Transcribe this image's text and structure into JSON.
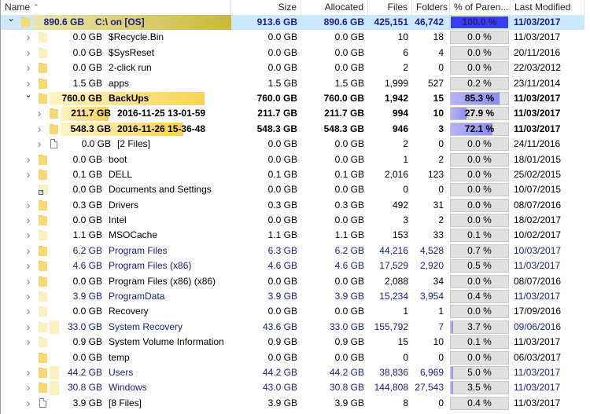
{
  "colors": {
    "selection": "#cce8ff",
    "blue_text": "#202080",
    "pct_fill": "#8c8cf2",
    "pct_fill_root": "#3c3cf0",
    "pct_bg": "#e0e0e0"
  },
  "columns": {
    "name": "Name",
    "size": "Size",
    "allocated": "Allocated",
    "files": "Files",
    "folders": "Folders",
    "percent": "% of Paren...",
    "modified": "Last Modified",
    "sort_icon": "sort-ascending-icon"
  },
  "rows": [
    {
      "level": 0,
      "expanded": true,
      "icon": "folder",
      "gb": "890.6 GB",
      "name": "C:\\  on  [OS]",
      "size": "913.6 GB",
      "allocated": "890.6 GB",
      "files": "425,151",
      "folders": "46,742",
      "percent": "100.0 %",
      "pct_value": 100.0,
      "modified": "11/03/2017",
      "bold": true,
      "blue": true,
      "selected": true,
      "size_fraction": 1.0
    },
    {
      "level": 1,
      "expanded": false,
      "icon": "folder-pale",
      "gb": "0.0 GB",
      "name": "$Recycle.Bin",
      "size": "0.0 GB",
      "allocated": "0.0 GB",
      "files": "10",
      "folders": "18",
      "percent": "0.0 %",
      "pct_value": 0.0,
      "modified": "11/03/2017"
    },
    {
      "level": 1,
      "expanded": false,
      "icon": "folder-pale",
      "gb": "0.0 GB",
      "name": "$SysReset",
      "size": "0.0 GB",
      "allocated": "0.0 GB",
      "files": "6",
      "folders": "4",
      "percent": "0.0 %",
      "pct_value": 0.0,
      "modified": "20/11/2016"
    },
    {
      "level": 1,
      "expanded": false,
      "icon": "folder",
      "gb": "0.0 GB",
      "name": "2-click run",
      "size": "0.0 GB",
      "allocated": "0.0 GB",
      "files": "2",
      "folders": "0",
      "percent": "0.0 %",
      "pct_value": 0.0,
      "modified": "22/03/2012"
    },
    {
      "level": 1,
      "expanded": false,
      "icon": "folder",
      "gb": "1.5 GB",
      "name": "apps",
      "size": "1.5 GB",
      "allocated": "1.5 GB",
      "files": "1,999",
      "folders": "527",
      "percent": "0.2 %",
      "pct_value": 0.2,
      "modified": "23/11/2014"
    },
    {
      "level": 1,
      "expanded": true,
      "icon": "folder",
      "gb": "760.0 GB",
      "name": "BackUps",
      "size": "760.0 GB",
      "allocated": "760.0 GB",
      "files": "1,942",
      "folders": "15",
      "percent": "85.3 %",
      "pct_value": 85.3,
      "modified": "11/03/2017",
      "bold": true,
      "size_fraction": 0.853
    },
    {
      "level": 2,
      "expanded": false,
      "icon": "folder",
      "gb": "211.7 GB",
      "name": "2016-11-25 13-01-59",
      "size": "211.7 GB",
      "allocated": "211.7 GB",
      "files": "994",
      "folders": "10",
      "percent": "27.9 %",
      "pct_value": 27.9,
      "modified": "11/03/2017",
      "bold": true,
      "size_fraction": 0.279
    },
    {
      "level": 2,
      "expanded": false,
      "icon": "folder",
      "gb": "548.3 GB",
      "name": "2016-11-26 15-36-48",
      "size": "548.3 GB",
      "allocated": "548.3 GB",
      "files": "946",
      "folders": "3",
      "percent": "72.1 %",
      "pct_value": 72.1,
      "modified": "11/03/2017",
      "bold": true,
      "size_fraction": 0.721
    },
    {
      "level": 2,
      "expanded": false,
      "icon": "file",
      "gb": "0.0 GB",
      "name": "[2 Files]",
      "size": "0.0 GB",
      "allocated": "0.0 GB",
      "files": "2",
      "folders": "0",
      "percent": "0.0 %",
      "pct_value": 0.0,
      "modified": "24/11/2016"
    },
    {
      "level": 1,
      "expanded": false,
      "icon": "folder",
      "gb": "0.0 GB",
      "name": "boot",
      "size": "0.0 GB",
      "allocated": "0.0 GB",
      "files": "1",
      "folders": "2",
      "percent": "0.0 %",
      "pct_value": 0.0,
      "modified": "18/01/2015"
    },
    {
      "level": 1,
      "expanded": false,
      "icon": "folder",
      "gb": "0.1 GB",
      "name": "DELL",
      "size": "0.1 GB",
      "allocated": "0.1 GB",
      "files": "2,016",
      "folders": "123",
      "percent": "0.0 %",
      "pct_value": 0.0,
      "modified": "25/02/2015"
    },
    {
      "level": 1,
      "expanded": null,
      "icon": "shortcut",
      "gb": "0.0 GB",
      "name": "Documents and Settings",
      "size": "0.0 GB",
      "allocated": "0.0 GB",
      "files": "0",
      "folders": "0",
      "percent": "0.0 %",
      "pct_value": 0.0,
      "modified": "10/07/2015"
    },
    {
      "level": 1,
      "expanded": false,
      "icon": "folder",
      "gb": "0.3 GB",
      "name": "Drivers",
      "size": "0.3 GB",
      "allocated": "0.3 GB",
      "files": "492",
      "folders": "31",
      "percent": "0.0 %",
      "pct_value": 0.0,
      "modified": "08/07/2016"
    },
    {
      "level": 1,
      "expanded": false,
      "icon": "folder",
      "gb": "0.0 GB",
      "name": "Intel",
      "size": "0.0 GB",
      "allocated": "0.0 GB",
      "files": "3",
      "folders": "2",
      "percent": "0.0 %",
      "pct_value": 0.0,
      "modified": "18/02/2017"
    },
    {
      "level": 1,
      "expanded": false,
      "icon": "folder-pale",
      "gb": "1.1 GB",
      "name": "MSOCache",
      "size": "1.1 GB",
      "allocated": "1.1 GB",
      "files": "153",
      "folders": "33",
      "percent": "0.1 %",
      "pct_value": 0.1,
      "modified": "10/02/2017"
    },
    {
      "level": 1,
      "expanded": false,
      "icon": "folder",
      "gb": "6.2 GB",
      "name": "Program Files",
      "size": "6.3 GB",
      "allocated": "6.2 GB",
      "files": "44,216",
      "folders": "4,528",
      "percent": "0.7 %",
      "pct_value": 0.7,
      "modified": "10/03/2017",
      "blue": true
    },
    {
      "level": 1,
      "expanded": false,
      "icon": "folder",
      "gb": "4.6 GB",
      "name": "Program Files (x86)",
      "size": "4.6 GB",
      "allocated": "4.6 GB",
      "files": "17,529",
      "folders": "2,920",
      "percent": "0.5 %",
      "pct_value": 0.5,
      "modified": "11/03/2017",
      "blue": true
    },
    {
      "level": 1,
      "expanded": false,
      "icon": "folder",
      "gb": "0.0 GB",
      "name": "Program Files (x86) (x86)",
      "size": "0.0 GB",
      "allocated": "0.0 GB",
      "files": "2,088",
      "folders": "34",
      "percent": "0.0 %",
      "pct_value": 0.0,
      "modified": "08/07/2016"
    },
    {
      "level": 1,
      "expanded": false,
      "icon": "folder-pale",
      "gb": "3.9 GB",
      "name": "ProgramData",
      "size": "3.9 GB",
      "allocated": "3.9 GB",
      "files": "15,234",
      "folders": "3,954",
      "percent": "0.4 %",
      "pct_value": 0.4,
      "modified": "11/03/2017",
      "blue": true
    },
    {
      "level": 1,
      "expanded": false,
      "icon": "folder-pale",
      "gb": "0.0 GB",
      "name": "Recovery",
      "size": "0.0 GB",
      "allocated": "0.0 GB",
      "files": "1",
      "folders": "1",
      "percent": "0.0 %",
      "pct_value": 0.0,
      "modified": "17/09/2016"
    },
    {
      "level": 1,
      "expanded": false,
      "icon": "folder-pale",
      "gb": "33.0 GB",
      "name": "System Recovery",
      "size": "43.6 GB",
      "allocated": "33.0 GB",
      "files": "155,792",
      "folders": "7",
      "percent": "3.7 %",
      "pct_value": 3.7,
      "modified": "09/06/2016",
      "blue": true,
      "size_fraction": 0.037
    },
    {
      "level": 1,
      "expanded": false,
      "icon": "folder-pale",
      "gb": "0.9 GB",
      "name": "System Volume Information",
      "size": "0.9 GB",
      "allocated": "0.9 GB",
      "files": "15",
      "folders": "10",
      "percent": "0.1 %",
      "pct_value": 0.1,
      "modified": "11/03/2017"
    },
    {
      "level": 1,
      "expanded": null,
      "icon": "folder",
      "gb": "0.0 GB",
      "name": "temp",
      "size": "0.0 GB",
      "allocated": "0.0 GB",
      "files": "0",
      "folders": "0",
      "percent": "0.0 %",
      "pct_value": 0.0,
      "modified": "06/03/2017"
    },
    {
      "level": 1,
      "expanded": false,
      "icon": "folder",
      "gb": "44.2 GB",
      "name": "Users",
      "size": "44.2 GB",
      "allocated": "44.2 GB",
      "files": "38,836",
      "folders": "6,969",
      "percent": "5.0 %",
      "pct_value": 5.0,
      "modified": "11/03/2017",
      "blue": true,
      "size_fraction": 0.05
    },
    {
      "level": 1,
      "expanded": false,
      "icon": "folder",
      "gb": "30.8 GB",
      "name": "Windows",
      "size": "43.0 GB",
      "allocated": "30.8 GB",
      "files": "144,808",
      "folders": "27,543",
      "percent": "3.5 %",
      "pct_value": 3.5,
      "modified": "11/03/2017",
      "blue": true,
      "size_fraction": 0.035
    },
    {
      "level": 1,
      "expanded": false,
      "icon": "file",
      "gb": "3.9 GB",
      "name": "[8 Files]",
      "size": "3.9 GB",
      "allocated": "3.9 GB",
      "files": "8",
      "folders": "0",
      "percent": "0.4 %",
      "pct_value": 0.4,
      "modified": "11/03/2017"
    }
  ]
}
